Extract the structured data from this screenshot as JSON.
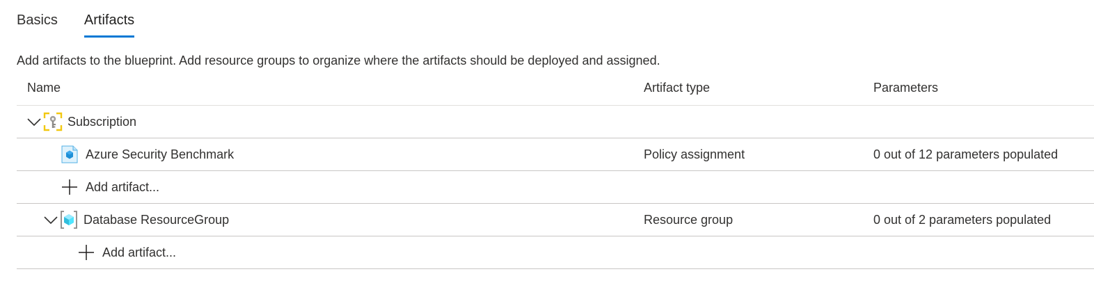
{
  "tabs": [
    {
      "label": "Basics",
      "active": false
    },
    {
      "label": "Artifacts",
      "active": true
    }
  ],
  "description": "Add artifacts to the blueprint. Add resource groups to organize where the artifacts should be deployed and assigned.",
  "columns": {
    "name": "Name",
    "artifact_type": "Artifact type",
    "parameters": "Parameters"
  },
  "rows": [
    {
      "name": "Subscription",
      "type": "",
      "params": "",
      "icon": "subscription-key-icon"
    },
    {
      "name": "Azure Security Benchmark",
      "type": "Policy assignment",
      "params": "0 out of 12 parameters populated",
      "icon": "policy-icon"
    },
    {
      "name": "Add artifact...",
      "icon": "plus-icon"
    },
    {
      "name": "Database ResourceGroup",
      "type": "Resource group",
      "params": "0 out of 2 parameters populated",
      "icon": "resource-group-icon"
    },
    {
      "name": "Add artifact...",
      "icon": "plus-icon"
    }
  ],
  "colors": {
    "accent": "#0078d4",
    "subscription_icon": "#f2c811",
    "resource_group_icon": "#50e6ff"
  }
}
